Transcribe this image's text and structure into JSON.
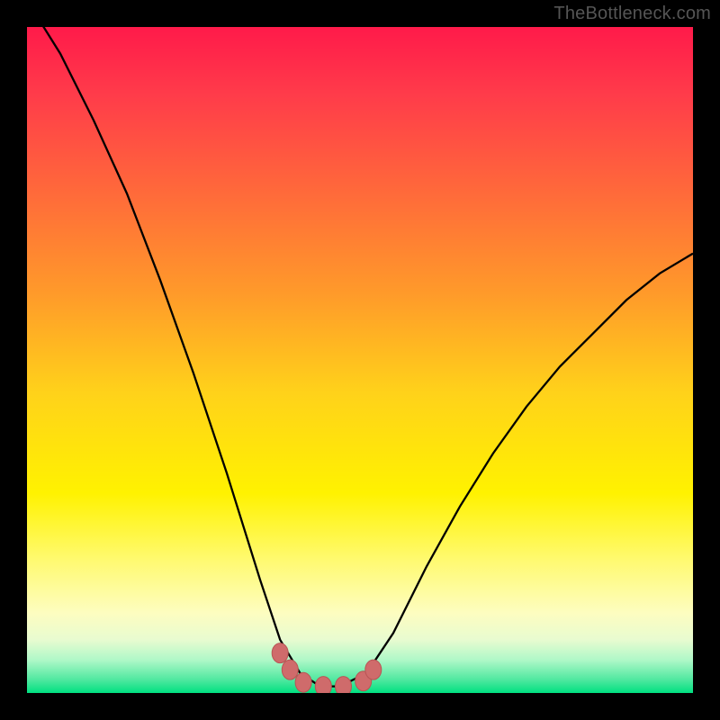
{
  "watermark": "TheBottleneck.com",
  "colors": {
    "frame": "#000000",
    "curve": "#000000",
    "marker_fill": "#cf6b6b",
    "marker_stroke": "#b85555",
    "gradient_top": "#ff1a4a",
    "gradient_bottom": "#00e080"
  },
  "chart_data": {
    "type": "line",
    "title": "",
    "xlabel": "",
    "ylabel": "",
    "xlim": [
      0,
      1
    ],
    "ylim": [
      0,
      1
    ],
    "x": [
      0.0,
      0.05,
      0.1,
      0.15,
      0.2,
      0.25,
      0.3,
      0.35,
      0.38,
      0.41,
      0.44,
      0.47,
      0.51,
      0.55,
      0.6,
      0.65,
      0.7,
      0.75,
      0.8,
      0.85,
      0.9,
      0.95,
      1.0
    ],
    "y": [
      1.04,
      0.96,
      0.86,
      0.75,
      0.62,
      0.48,
      0.33,
      0.17,
      0.08,
      0.03,
      0.01,
      0.01,
      0.03,
      0.09,
      0.19,
      0.28,
      0.36,
      0.43,
      0.49,
      0.54,
      0.59,
      0.63,
      0.66
    ],
    "markers": {
      "x": [
        0.38,
        0.395,
        0.415,
        0.445,
        0.475,
        0.505,
        0.52
      ],
      "y": [
        0.06,
        0.035,
        0.016,
        0.01,
        0.01,
        0.018,
        0.035
      ]
    }
  }
}
